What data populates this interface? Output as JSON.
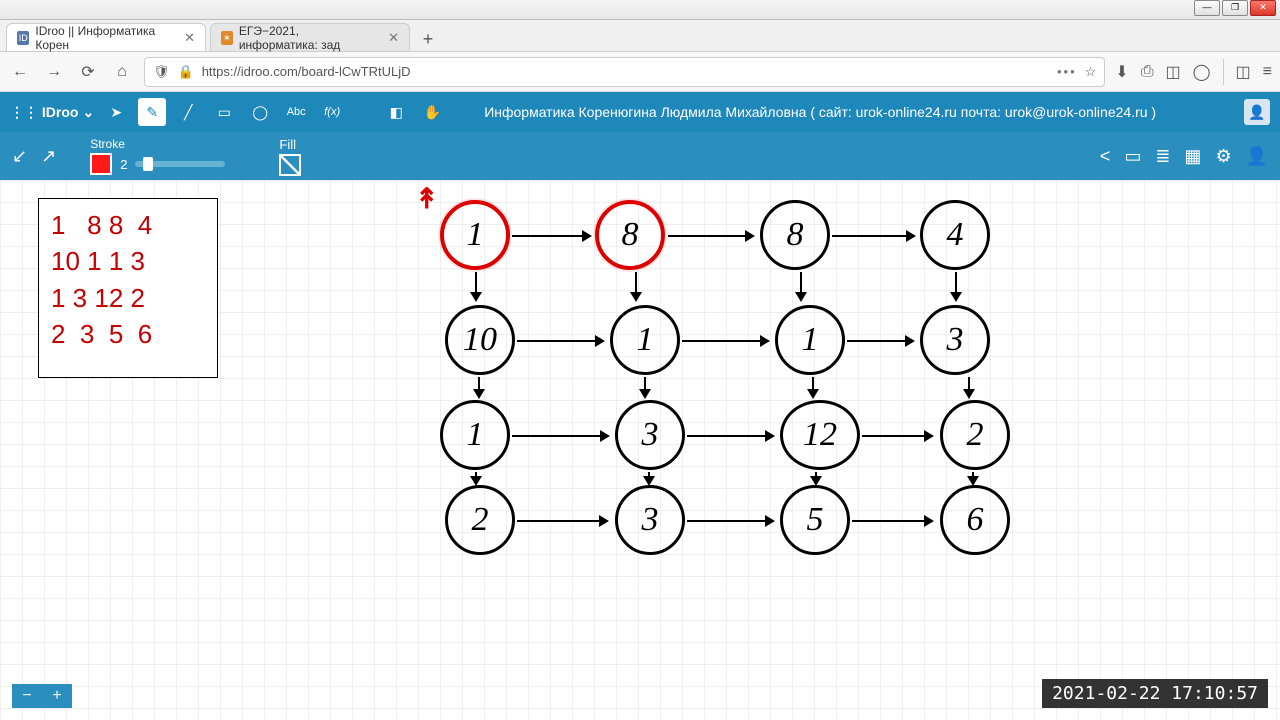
{
  "window": {
    "minimize": "—",
    "maximize": "❐",
    "close": "✕"
  },
  "tabs": {
    "t0": {
      "label": "IDroo || Информатика Корен",
      "close": "✕",
      "fav": "ID"
    },
    "t1": {
      "label": "ЕГЭ−2021, информатика: зад",
      "close": "✕",
      "fav": "✶"
    },
    "newtab": "+"
  },
  "nav": {
    "back": "←",
    "forward": "→",
    "reload": "⟳",
    "home": "⌂"
  },
  "url": {
    "shield": "🛡",
    "lock": "🔒",
    "text": "https://idroo.com/board-lCwTRtULjD",
    "dots": "•••",
    "star": "☆"
  },
  "right_icons": {
    "download": "⬇",
    "library": "⎙",
    "sidebar": "◫",
    "account": "◯",
    "ext": "◫",
    "menu": "≡"
  },
  "idroo": {
    "logo": "⋮⋮ IDroo",
    "dropdown": "⌄",
    "board_title": "Информатика Коренюгина Людмила Михайловна  ( сайт: urok-online24.ru   почта: urok@urok-online24.ru )",
    "tools": {
      "pointer": "➤",
      "pen": "✎",
      "line": "╱",
      "rect": "▭",
      "ellipse": "◯",
      "text": "Abc",
      "formula": "f(x)",
      "eraser": "◧",
      "hand": "✋"
    },
    "avatar": "👤"
  },
  "subbar": {
    "down_left": "↙",
    "up_right": "↗",
    "stroke_label": "Stroke",
    "stroke_value": "2",
    "fill_label": "Fill",
    "share": "<",
    "chat": "▭",
    "doc": "≣",
    "image": "▦",
    "settings": "⚙",
    "user": "👤"
  },
  "matrix": {
    "r0": "1   8 8  4",
    "r1": "10 1 1 3",
    "r2": "1 3 12 2",
    "r3": "2  3  5  6"
  },
  "graph": {
    "n00": "1",
    "n01": "8",
    "n02": "8",
    "n03": "4",
    "n10": "10",
    "n11": "1",
    "n12": "1",
    "n13": "3",
    "n20": "1",
    "n21": "3",
    "n22": "12",
    "n23": "2",
    "n30": "2",
    "n31": "3",
    "n32": "5",
    "n33": "6",
    "red_arrow": "↟"
  },
  "zoom": {
    "minus": "−",
    "plus": "+"
  },
  "timestamp": "2021-02-22  17:10:57",
  "colors": {
    "accent": "#2a8fbf",
    "stroke": "#ff1a1a"
  }
}
